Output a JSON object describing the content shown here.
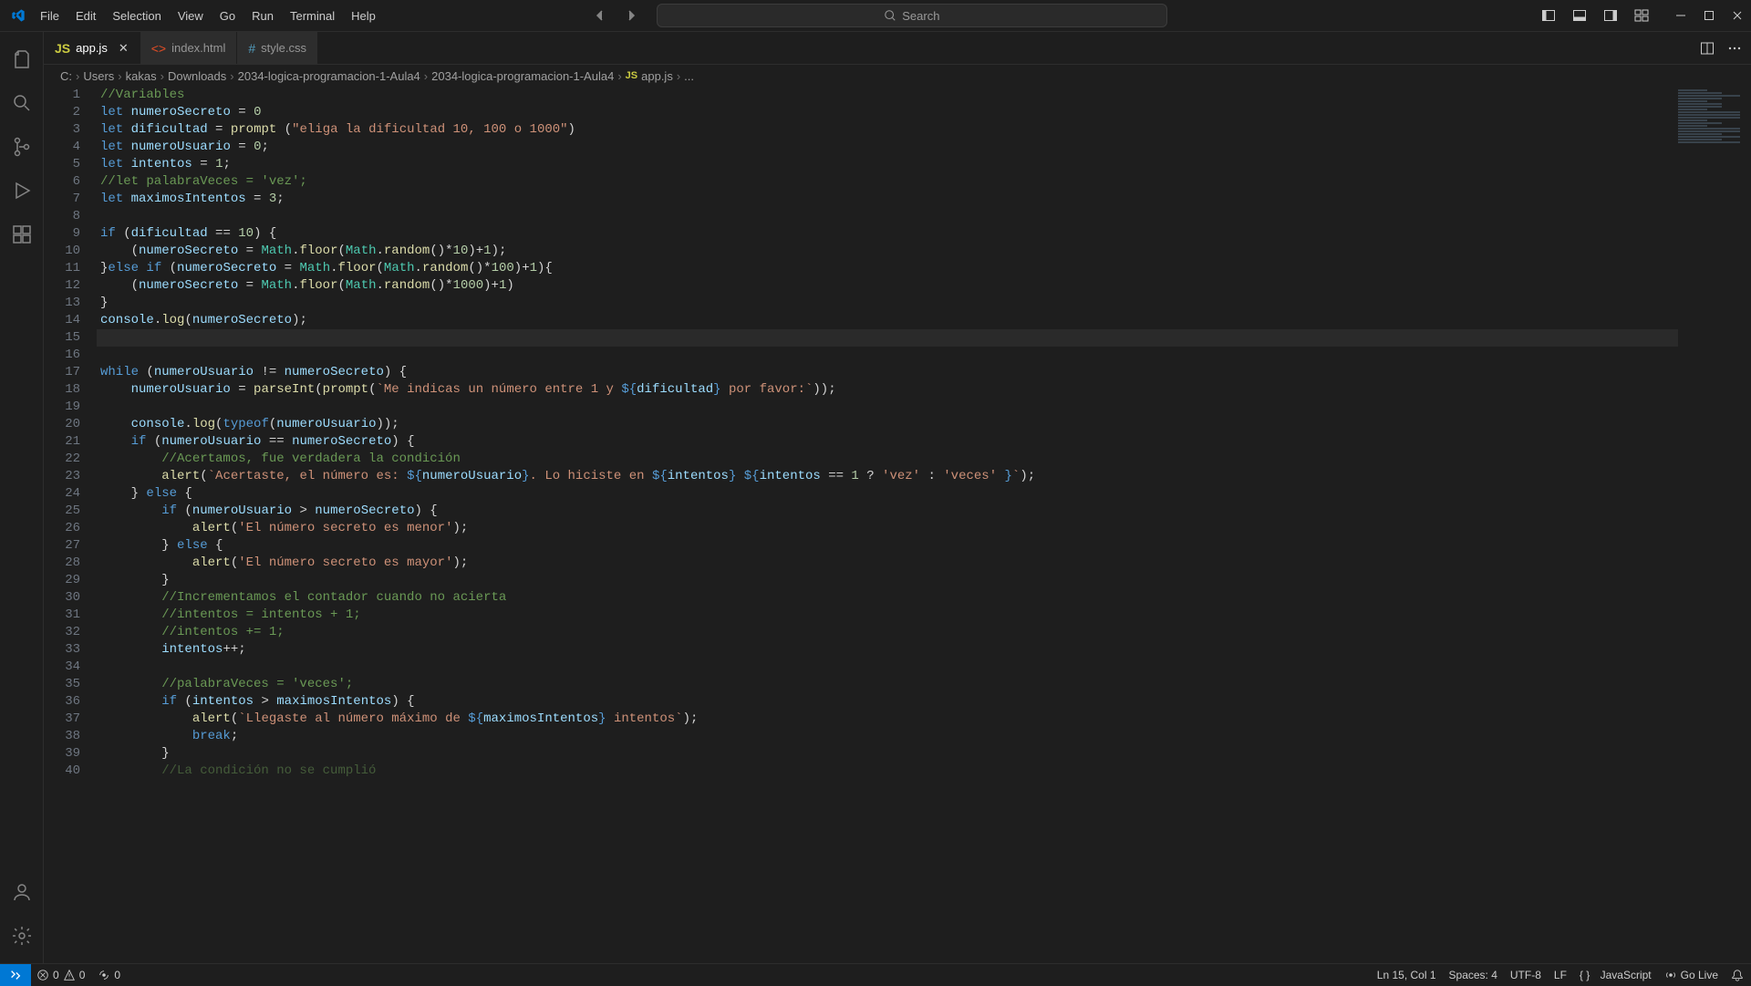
{
  "menu": {
    "file": "File",
    "edit": "Edit",
    "selection": "Selection",
    "view": "View",
    "go": "Go",
    "run": "Run",
    "terminal": "Terminal",
    "help": "Help"
  },
  "search": {
    "placeholder": "Search"
  },
  "tabs": [
    {
      "label": "app.js",
      "icon": "JS",
      "active": true
    },
    {
      "label": "index.html",
      "icon": "<>",
      "active": false
    },
    {
      "label": "style.css",
      "icon": "#",
      "active": false
    }
  ],
  "breadcrumb": {
    "parts": [
      "C:",
      "Users",
      "kakas",
      "Downloads",
      "2034-logica-programacion-1-Aula4",
      "2034-logica-programacion-1-Aula4"
    ],
    "file": "app.js",
    "tail": "..."
  },
  "code": {
    "line1_cm": "//Variables",
    "line2": {
      "let": "let",
      "var": "numeroSecreto",
      "rest": " = ",
      "num": "0"
    },
    "line3": {
      "let": "let",
      "var": "dificultad",
      "eq": " = ",
      "fn": "prompt",
      "op": " (",
      "str": "\"eliga la dificultad 10, 100 o 1000\"",
      "cp": ")"
    },
    "line4": {
      "let": "let",
      "var": "numeroUsuario",
      "rest": " = ",
      "num": "0",
      "sc": ";"
    },
    "line5": {
      "let": "let",
      "var": "intentos",
      "rest": " = ",
      "num": "1",
      "sc": ";"
    },
    "line6_cm": "//let palabraVeces = 'vez';",
    "line7": {
      "let": "let",
      "var": "maximosIntentos",
      "rest": " = ",
      "num": "3",
      "sc": ";"
    },
    "line9": {
      "if": "if",
      "op": " (",
      "var": "dificultad",
      "eq": " == ",
      "num": "10",
      "cp": ") {"
    },
    "line10": {
      "ind": "    (",
      "var": "numeroSecreto",
      "eq": " = ",
      "cs": "Math",
      "dot": ".",
      "fn": "floor",
      "op": "(",
      "cs2": "Math",
      "dot2": ".",
      "fn2": "random",
      "par": "()*",
      "num": "10",
      "par2": ")+",
      "num2": "1",
      "end": ");"
    },
    "line11": {
      "close": "}",
      "else": "else",
      "if": "if",
      "op": " (",
      "var": "numeroSecreto",
      "eq": " = ",
      "cs": "Math",
      "dot": ".",
      "fn": "floor",
      "op2": "(",
      "cs2": "Math",
      "dot2": ".",
      "fn2": "random",
      "par": "()*",
      "num": "100",
      "par2": ")+",
      "num2": "1",
      "end": "){"
    },
    "line12": {
      "ind": "    (",
      "var": "numeroSecreto",
      "eq": " = ",
      "cs": "Math",
      "dot": ".",
      "fn": "floor",
      "op": "(",
      "cs2": "Math",
      "dot2": ".",
      "fn2": "random",
      "par": "()*",
      "num": "1000",
      "par2": ")+",
      "num2": "1",
      "end": ")"
    },
    "line13": "}",
    "line14": {
      "cs": "console",
      "dot": ".",
      "fn": "log",
      "op": "(",
      "var": "numeroSecreto",
      "end": ");"
    },
    "line17": {
      "while": "while",
      "op": " (",
      "var": "numeroUsuario",
      "neq": " != ",
      "var2": "numeroSecreto",
      "cp": ") {"
    },
    "line18": {
      "ind": "    ",
      "var": "numeroUsuario",
      "eq": " = ",
      "fn": "parseInt",
      "op": "(",
      "fn2": "prompt",
      "op2": "(",
      "str1": "`Me indicas un número entre 1 y ",
      "tpl": "${",
      "var2": "dificultad",
      "tplc": "}",
      "str2": " por favor:`",
      "end": "));"
    },
    "line20": {
      "ind": "    ",
      "cs": "console",
      "dot": ".",
      "fn": "log",
      "op": "(",
      "kw": "typeof",
      "op2": "(",
      "var": "numeroUsuario",
      "end": "));"
    },
    "line21": {
      "ind": "    ",
      "if": "if",
      "op": " (",
      "var": "numeroUsuario",
      "eq": " == ",
      "var2": "numeroSecreto",
      "cp": ") {"
    },
    "line22_cm": "        //Acertamos, fue verdadera la condición",
    "line23": {
      "ind": "        ",
      "fn": "alert",
      "op": "(",
      "str1": "`Acertaste, el número es: ",
      "tpl1": "${",
      "var1": "numeroUsuario",
      "tplc1": "}",
      "str2": ". Lo hiciste en ",
      "tpl2": "${",
      "var2": "intentos",
      "tplc2": "}",
      "str3": " ",
      "tpl3": "${",
      "var3": "intentos",
      "eq": " == ",
      "num": "1",
      "tern": " ? ",
      "s1": "'vez'",
      "col": " : ",
      "s2": "'veces'",
      "sp": " ",
      "tplc3": "}",
      "str4": "`",
      "end": ");"
    },
    "line24": {
      "ind": "    } ",
      "else": "else",
      "br": " {"
    },
    "line25": {
      "ind": "        ",
      "if": "if",
      "op": " (",
      "var": "numeroUsuario",
      "gt": " > ",
      "var2": "numeroSecreto",
      "cp": ") {"
    },
    "line26": {
      "ind": "            ",
      "fn": "alert",
      "op": "(",
      "str": "'El número secreto es menor'",
      "end": ");"
    },
    "line27": {
      "ind": "        } ",
      "else": "else",
      "br": " {"
    },
    "line28": {
      "ind": "            ",
      "fn": "alert",
      "op": "(",
      "str": "'El número secreto es mayor'",
      "end": ");"
    },
    "line29": "        }",
    "line30_cm": "        //Incrementamos el contador cuando no acierta",
    "line31_cm": "        //intentos = intentos + 1;",
    "line32_cm": "        //intentos += 1;",
    "line33": {
      "ind": "        ",
      "var": "intentos",
      "op": "++;"
    },
    "line35_cm": "        //palabraVeces = 'veces';",
    "line36": {
      "ind": "        ",
      "if": "if",
      "op": " (",
      "var": "intentos",
      "gt": " > ",
      "var2": "maximosIntentos",
      "cp": ") {"
    },
    "line37": {
      "ind": "            ",
      "fn": "alert",
      "op": "(",
      "str1": "`Llegaste al número máximo de ",
      "tpl": "${",
      "var": "maximosIntentos",
      "tplc": "}",
      "str2": " intentos`",
      "end": ");"
    },
    "line38": {
      "ind": "            ",
      "kw": "break",
      "sc": ";"
    },
    "line39": "        }",
    "line40_cm": "        //La condición no se cumplió"
  },
  "status": {
    "errors": "0",
    "warnings": "0",
    "ports": "0",
    "position": "Ln 15, Col 1",
    "spaces": "Spaces: 4",
    "encoding": "UTF-8",
    "eol": "LF",
    "language": "JavaScript",
    "golive": "Go Live"
  },
  "lineNumbers": [
    "1",
    "2",
    "3",
    "4",
    "5",
    "6",
    "7",
    "8",
    "9",
    "10",
    "11",
    "12",
    "13",
    "14",
    "15",
    "16",
    "17",
    "18",
    "19",
    "20",
    "21",
    "22",
    "23",
    "24",
    "25",
    "26",
    "27",
    "28",
    "29",
    "30",
    "31",
    "32",
    "33",
    "34",
    "35",
    "36",
    "37",
    "38",
    "39",
    "40"
  ]
}
